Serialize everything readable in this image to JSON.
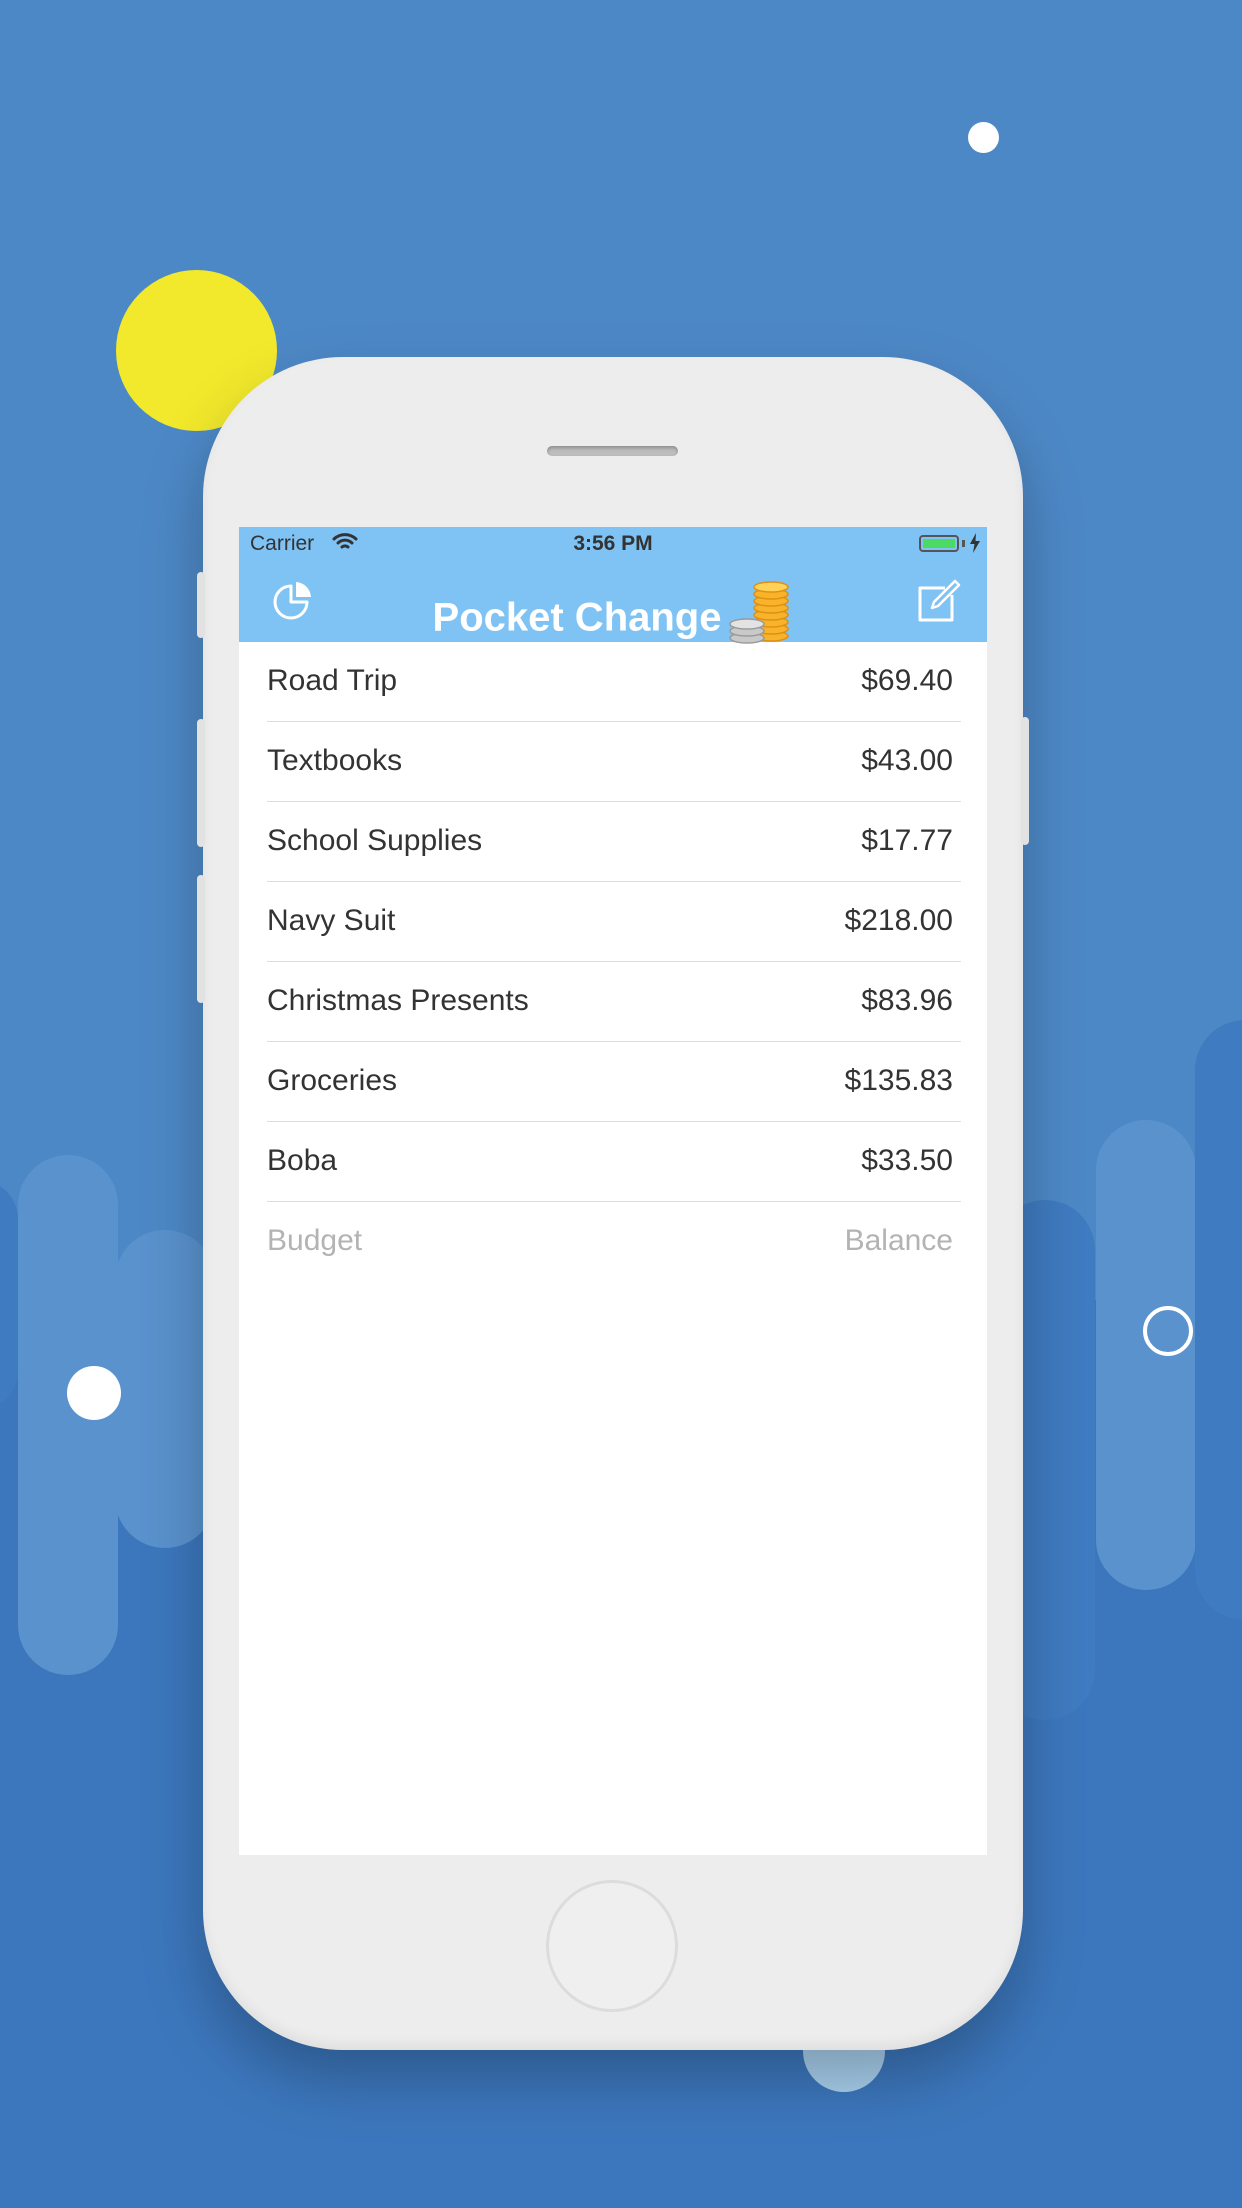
{
  "status_bar": {
    "carrier": "Carrier",
    "time": "3:56 PM"
  },
  "nav": {
    "title": "Pocket Change"
  },
  "expenses": [
    {
      "name": "Road Trip",
      "amount": "$69.40"
    },
    {
      "name": "Textbooks",
      "amount": "$43.00"
    },
    {
      "name": "School Supplies",
      "amount": "$17.77"
    },
    {
      "name": "Navy Suit",
      "amount": "$218.00"
    },
    {
      "name": "Christmas Presents",
      "amount": "$83.96"
    },
    {
      "name": "Groceries",
      "amount": "$135.83"
    },
    {
      "name": "Boba",
      "amount": "$33.50"
    }
  ],
  "new_entry": {
    "budget_placeholder": "Budget",
    "balance_placeholder": "Balance"
  },
  "icons": {
    "left": "pie-chart-icon",
    "right": "compose-icon",
    "title": "coins-icon",
    "status": [
      "wifi-icon",
      "battery-icon",
      "charging-icon"
    ]
  },
  "colors": {
    "background": "#4d88c6",
    "nav_bar": "#7fc3f5",
    "accent_circle": "#f2e92c",
    "text": "#333333",
    "placeholder": "#b3b3b3"
  }
}
